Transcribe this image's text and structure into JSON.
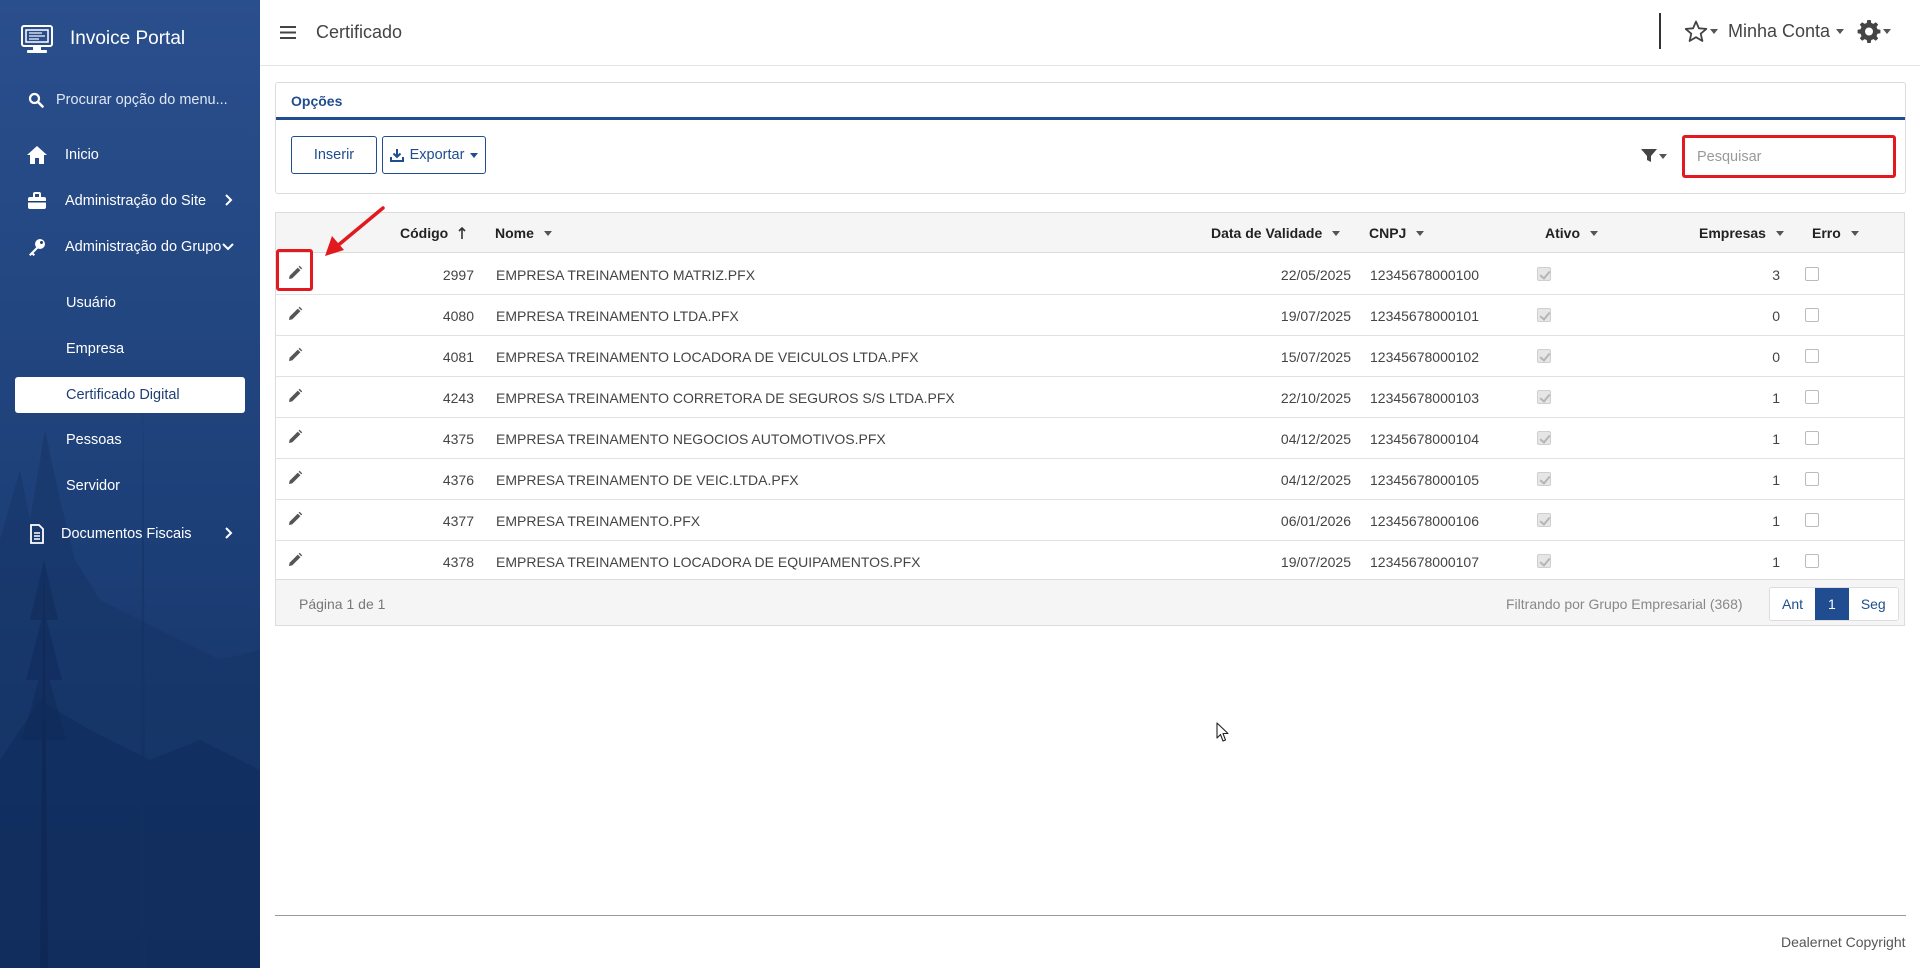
{
  "brand": {
    "name": "Invoice Portal"
  },
  "sidebar": {
    "search_placeholder": "Procurar opção do menu...",
    "items": [
      {
        "label": "Inicio",
        "icon": "home-icon"
      },
      {
        "label": "Administração do Site",
        "icon": "briefcase-icon"
      },
      {
        "label": "Administração do Grupo",
        "icon": "key-icon"
      },
      {
        "label": "Documentos Fiscais",
        "icon": "document-icon"
      }
    ],
    "subitems": [
      "Usuário",
      "Empresa",
      "Certificado Digital",
      "Pessoas",
      "Servidor"
    ],
    "active_subitem": "Certificado Digital"
  },
  "header": {
    "title": "Certificado",
    "account_label": "Minha Conta"
  },
  "options": {
    "title": "Opções",
    "insert_label": "Inserir",
    "export_label": "Exportar",
    "search_placeholder": "Pesquisar"
  },
  "table": {
    "columns": {
      "codigo": "Código",
      "nome": "Nome",
      "data_validade": "Data de Validade",
      "cnpj": "CNPJ",
      "ativo": "Ativo",
      "empresas": "Empresas",
      "erro": "Erro"
    },
    "rows": [
      {
        "codigo": "2997",
        "nome": "EMPRESA TREINAMENTO MATRIZ.PFX",
        "data": "22/05/2025",
        "cnpj": "12345678000100",
        "ativo": true,
        "empresas": "3",
        "erro": false
      },
      {
        "codigo": "4080",
        "nome": "EMPRESA TREINAMENTO LTDA.PFX",
        "data": "19/07/2025",
        "cnpj": "12345678000101",
        "ativo": true,
        "empresas": "0",
        "erro": false
      },
      {
        "codigo": "4081",
        "nome": "EMPRESA TREINAMENTO LOCADORA DE VEICULOS LTDA.PFX",
        "data": "15/07/2025",
        "cnpj": "12345678000102",
        "ativo": true,
        "empresas": "0",
        "erro": false
      },
      {
        "codigo": "4243",
        "nome": "EMPRESA TREINAMENTO CORRETORA DE SEGUROS S/S LTDA.PFX",
        "data": "22/10/2025",
        "cnpj": "12345678000103",
        "ativo": true,
        "empresas": "1",
        "erro": false
      },
      {
        "codigo": "4375",
        "nome": "EMPRESA TREINAMENTO NEGOCIOS AUTOMOTIVOS.PFX",
        "data": "04/12/2025",
        "cnpj": "12345678000104",
        "ativo": true,
        "empresas": "1",
        "erro": false
      },
      {
        "codigo": "4376",
        "nome": "EMPRESA TREINAMENTO DE VEIC.LTDA.PFX",
        "data": "04/12/2025",
        "cnpj": "12345678000105",
        "ativo": true,
        "empresas": "1",
        "erro": false
      },
      {
        "codigo": "4377",
        "nome": "EMPRESA TREINAMENTO.PFX",
        "data": "06/01/2026",
        "cnpj": "12345678000106",
        "ativo": true,
        "empresas": "1",
        "erro": false
      },
      {
        "codigo": "4378",
        "nome": "EMPRESA TREINAMENTO LOCADORA DE EQUIPAMENTOS.PFX",
        "data": "19/07/2025",
        "cnpj": "12345678000107",
        "ativo": true,
        "empresas": "1",
        "erro": false
      }
    ],
    "footer": {
      "page_info": "Página 1 de 1",
      "filter_info": "Filtrando por Grupo Empresarial (368)",
      "prev_label": "Ant",
      "current_page": "1",
      "next_label": "Seg"
    }
  },
  "footer": {
    "copyright": "Dealernet Copyright"
  },
  "colors": {
    "sidebar_bg": "#1d3f78",
    "accent": "#1f4d8f",
    "highlight": "#e2191e"
  }
}
